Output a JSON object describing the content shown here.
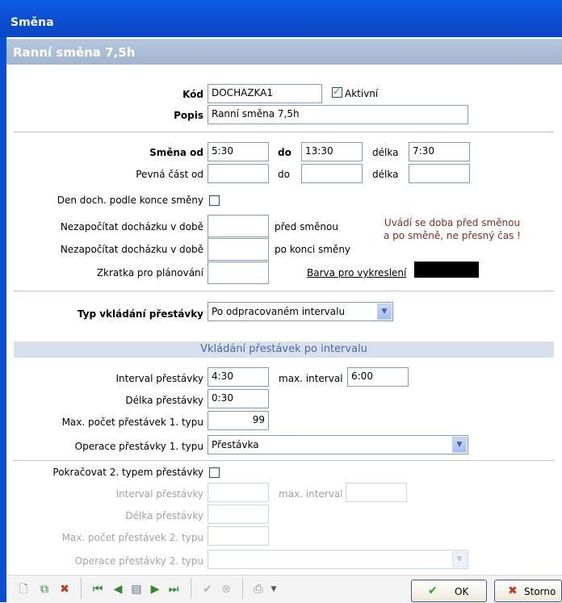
{
  "window": {
    "title": "Směna"
  },
  "header": {
    "subtitle": "Ranní směna 7,5h"
  },
  "form": {
    "kod_label": "Kód",
    "kod_value": "DOCHAZKA1",
    "aktivni_label": "Aktivní",
    "aktivni_checked": true,
    "popis_label": "Popis",
    "popis_value": "Ranní směna 7,5h",
    "smena_od_label": "Směna od",
    "smena_od_value": "5:30",
    "do_label": "do",
    "smena_do_value": "13:30",
    "delka_label": "délka",
    "smena_delka_value": "7:30",
    "pevna_label": "Pevná část od",
    "pevna_od_value": "",
    "pevna_do_label": "do",
    "pevna_do_value": "",
    "pevna_delka_label": "délka",
    "pevna_delka_value": "",
    "den_doch_label": "Den doch. podle konce směny",
    "den_doch_checked": false,
    "nezapocitat_pred_label": "Nezapočítat docházku v době",
    "nezapocitat_pred_value": "",
    "pred_smenou_label": "před směnou",
    "nezapocitat_po_label": "Nezapočítat docházku v době",
    "nezapocitat_po_value": "",
    "po_konci_label": "po konci směny",
    "note_line1": "Uvádí se doba před směnou",
    "note_line2": "a po směně, ne přesný čas !",
    "zkratka_label": "Zkratka pro plánování",
    "zkratka_value": "",
    "barva_label": "Barva pro vykreslení",
    "barva_color": "#000000",
    "typ_label": "Typ vkládání přestávky",
    "typ_value": "Po odpracovaném intervalu"
  },
  "section": {
    "title": "Vkládání přestávek po intervalu"
  },
  "breaks1": {
    "interval_label": "Interval přestávky",
    "interval_value": "4:30",
    "max_interval_label": "max. interval",
    "max_interval_value": "6:00",
    "delka_label": "Délka přestávky",
    "delka_value": "0:30",
    "max_pocet_label": "Max. počet přestávek 1. typu",
    "max_pocet_value": "99",
    "operace_label": "Operace přestávky 1. typu",
    "operace_value": "Přestávka"
  },
  "breaks2": {
    "pokracovat_label": "Pokračovat 2. typem přestávky",
    "pokracovat_checked": false,
    "interval_label": "Interval přestávky",
    "interval_value": "",
    "max_interval_label": "max. interval",
    "max_interval_value": "",
    "delka_label": "Délka přestávky",
    "delka_value": "",
    "max_pocet_label": "Max. počet přestávek 2. typu",
    "max_pocet_value": "",
    "operace_label": "Operace přestávky 2. typu",
    "operace_value": ""
  },
  "toolbar": {
    "icons": [
      "new-record-icon",
      "copy-record-icon",
      "delete-record-icon",
      "first-record-icon",
      "previous-record-icon",
      "edit-record-icon",
      "next-record-icon",
      "last-record-icon",
      "confirm-icon",
      "cancel-icon",
      "print-icon"
    ],
    "ok_label": "OK",
    "storno_label": "Storno"
  },
  "colors": {
    "accent": "#0a5ee6",
    "subheader": "#a9bcd5",
    "note": "#8b2a1c",
    "section_text": "#4a6aa2"
  }
}
